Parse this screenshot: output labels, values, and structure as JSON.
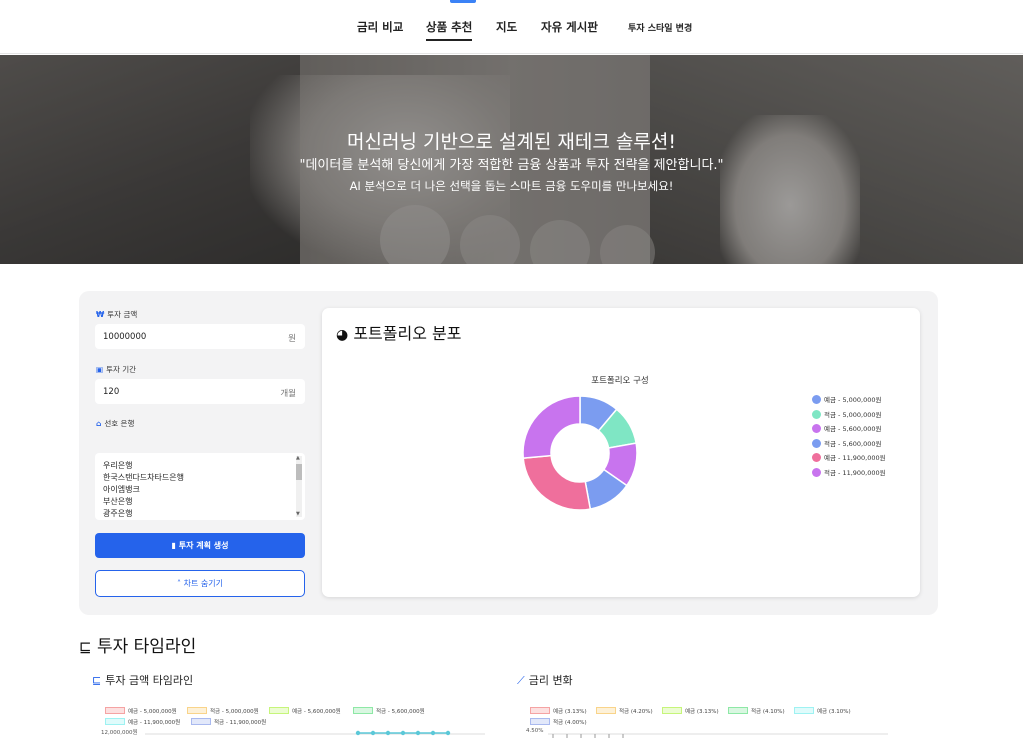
{
  "nav": {
    "items": [
      {
        "label": "금리 비교",
        "active": false
      },
      {
        "label": "상품 추천",
        "active": true
      },
      {
        "label": "지도",
        "active": false
      },
      {
        "label": "자유 게시판",
        "active": false
      },
      {
        "label": "투자 스타일 변경",
        "active": false
      }
    ]
  },
  "hero": {
    "title": "머신러닝 기반으로 설계된 재테크 솔루션!",
    "subtitle": "\"데이터를 분석해 당신에게 가장 적합한 금융 상품과 투자 전략을 제안합니다.\"",
    "subtitle2": "AI 분석으로 더 나은 선택을 돕는 스마트 금융 도우미를 만나보세요!"
  },
  "form": {
    "amount_label": "투자 금액",
    "amount_value": "10000000",
    "amount_unit": "원",
    "period_label": "투자 기간",
    "period_value": "120",
    "period_unit": "개월",
    "bank_label": "선호 은행",
    "banks": [
      "우리은행",
      "한국스탠다드차타드은행",
      "아이엠뱅크",
      "부산은행",
      "광주은행"
    ],
    "generate_button": "투자 계획 생성",
    "toggle_chart_button": "차트 숨기기"
  },
  "portfolio": {
    "card_title": "포트폴리오 분포",
    "chart_data": {
      "type": "pie",
      "title": "포트폴리오 구성",
      "donut": true,
      "legend_position": "right",
      "categories": [
        "예금 - 5,000,000원",
        "적금 - 5,000,000원",
        "예금 - 5,600,000원",
        "적금 - 5,600,000원",
        "예금 - 11,900,000원",
        "적금 - 11,900,000원"
      ],
      "values": [
        5000000,
        5000000,
        5600000,
        5600000,
        11900000,
        11900000
      ],
      "colors": [
        "#7b9cf0",
        "#7fe6c4",
        "#c874ee",
        "#7b9cf0",
        "#ef6f9c",
        "#c874ee"
      ]
    }
  },
  "timeline": {
    "title": "투자 타임라인",
    "amount_chart": {
      "title": "투자 금액 타임라인",
      "legend": [
        {
          "label": "예금 - 5,000,000원",
          "color": "#f5a3a3"
        },
        {
          "label": "적금 - 5,000,000원",
          "color": "#f9d48a"
        },
        {
          "label": "예금 - 5,600,000원",
          "color": "#c6f57a"
        },
        {
          "label": "적금 - 5,600,000원",
          "color": "#8ee8a6"
        },
        {
          "label": "예금 - 11,900,000원",
          "color": "#9ef2f2"
        },
        {
          "label": "적금 - 11,900,000원",
          "color": "#a9b9ef"
        }
      ],
      "y_top_tick": "12,000,000원"
    },
    "rate_chart": {
      "title": "금리 변화",
      "legend": [
        {
          "label": "예금 (3.13%)",
          "color": "#f5a3a3"
        },
        {
          "label": "적금 (4.20%)",
          "color": "#f9d48a"
        },
        {
          "label": "예금 (3.13%)",
          "color": "#c6f57a"
        },
        {
          "label": "적금 (4.10%)",
          "color": "#8ee8a6"
        },
        {
          "label": "예금 (3.10%)",
          "color": "#9ef2f2"
        },
        {
          "label": "적금 (4.00%)",
          "color": "#a9b9ef"
        }
      ],
      "y_top_tick": "4.50%"
    }
  }
}
